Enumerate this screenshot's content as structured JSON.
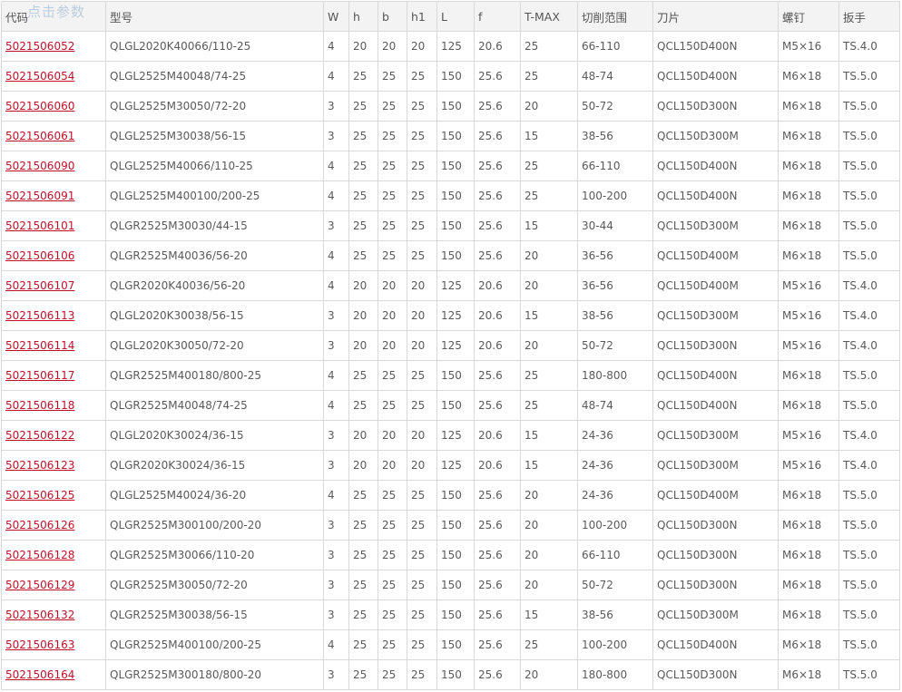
{
  "watermark": "点击参数",
  "table": {
    "headers": [
      "代码",
      "型号",
      "W",
      "h",
      "b",
      "h1",
      "L",
      "f",
      "T-MAX",
      "切削范围",
      "刀片",
      "螺钉",
      "扳手"
    ],
    "rows": [
      [
        "5021506052",
        "QLGL2020K40066/110-25",
        "4",
        "20",
        "20",
        "20",
        "125",
        "20.6",
        "25",
        "66-110",
        "QCL150D400N",
        "M5×16",
        "TS.4.0"
      ],
      [
        "5021506054",
        "QLGL2525M40048/74-25",
        "4",
        "25",
        "25",
        "25",
        "150",
        "25.6",
        "25",
        "48-74",
        "QCL150D400N",
        "M6×18",
        "TS.5.0"
      ],
      [
        "5021506060",
        "QLGL2525M30050/72-20",
        "3",
        "25",
        "25",
        "25",
        "150",
        "25.6",
        "20",
        "50-72",
        "QCL150D300N",
        "M6×18",
        "TS.5.0"
      ],
      [
        "5021506061",
        "QLGL2525M30038/56-15",
        "3",
        "25",
        "25",
        "25",
        "150",
        "25.6",
        "15",
        "38-56",
        "QCL150D300M",
        "M6×18",
        "TS.5.0"
      ],
      [
        "5021506090",
        "QLGL2525M40066/110-25",
        "4",
        "25",
        "25",
        "25",
        "150",
        "25.6",
        "25",
        "66-110",
        "QCL150D400N",
        "M6×18",
        "TS.5.0"
      ],
      [
        "5021506091",
        "QLGL2525M400100/200-25",
        "4",
        "25",
        "25",
        "25",
        "150",
        "25.6",
        "25",
        "100-200",
        "QCL150D400N",
        "M6×18",
        "TS.5.0"
      ],
      [
        "5021506101",
        "QLGR2525M30030/44-15",
        "3",
        "25",
        "25",
        "25",
        "150",
        "25.6",
        "15",
        "30-44",
        "QCL150D300M",
        "M6×18",
        "TS.5.0"
      ],
      [
        "5021506106",
        "QLGR2525M40036/56-20",
        "4",
        "25",
        "25",
        "25",
        "150",
        "25.6",
        "20",
        "36-56",
        "QCL150D400M",
        "M6×18",
        "TS.5.0"
      ],
      [
        "5021506107",
        "QLGR2020K40036/56-20",
        "4",
        "20",
        "20",
        "20",
        "125",
        "20.6",
        "20",
        "36-56",
        "QCL150D400M",
        "M5×16",
        "TS.4.0"
      ],
      [
        "5021506113",
        "QLGL2020K30038/56-15",
        "3",
        "20",
        "20",
        "20",
        "125",
        "20.6",
        "15",
        "38-56",
        "QCL150D300M",
        "M5×16",
        "TS.4.0"
      ],
      [
        "5021506114",
        "QLGL2020K30050/72-20",
        "3",
        "20",
        "20",
        "20",
        "125",
        "20.6",
        "20",
        "50-72",
        "QCL150D300N",
        "M5×16",
        "TS.4.0"
      ],
      [
        "5021506117",
        "QLGR2525M400180/800-25",
        "4",
        "25",
        "25",
        "25",
        "150",
        "25.6",
        "25",
        "180-800",
        "QCL150D400N",
        "M6×18",
        "TS.5.0"
      ],
      [
        "5021506118",
        "QLGR2525M40048/74-25",
        "4",
        "25",
        "25",
        "25",
        "150",
        "25.6",
        "25",
        "48-74",
        "QCL150D400N",
        "M6×18",
        "TS.5.0"
      ],
      [
        "5021506122",
        "QLGL2020K30024/36-15",
        "3",
        "20",
        "20",
        "20",
        "125",
        "20.6",
        "15",
        "24-36",
        "QCL150D300M",
        "M5×16",
        "TS.4.0"
      ],
      [
        "5021506123",
        "QLGR2020K30024/36-15",
        "3",
        "20",
        "20",
        "20",
        "125",
        "20.6",
        "15",
        "24-36",
        "QCL150D300M",
        "M5×16",
        "TS.4.0"
      ],
      [
        "5021506125",
        "QLGL2525M40024/36-20",
        "4",
        "25",
        "25",
        "25",
        "150",
        "25.6",
        "20",
        "24-36",
        "QCL150D400M",
        "M6×18",
        "TS.5.0"
      ],
      [
        "5021506126",
        "QLGR2525M300100/200-20",
        "3",
        "25",
        "25",
        "25",
        "150",
        "25.6",
        "20",
        "100-200",
        "QCL150D300N",
        "M6×18",
        "TS.5.0"
      ],
      [
        "5021506128",
        "QLGR2525M30066/110-20",
        "3",
        "25",
        "25",
        "25",
        "150",
        "25.6",
        "20",
        "66-110",
        "QCL150D300N",
        "M6×18",
        "TS.5.0"
      ],
      [
        "5021506129",
        "QLGR2525M30050/72-20",
        "3",
        "25",
        "25",
        "25",
        "150",
        "25.6",
        "20",
        "50-72",
        "QCL150D300N",
        "M6×18",
        "TS.5.0"
      ],
      [
        "5021506132",
        "QLGR2525M30038/56-15",
        "3",
        "25",
        "25",
        "25",
        "150",
        "25.6",
        "15",
        "38-56",
        "QCL150D300M",
        "M6×18",
        "TS.5.0"
      ],
      [
        "5021506163",
        "QLGR2525M400100/200-25",
        "4",
        "25",
        "25",
        "25",
        "150",
        "25.6",
        "25",
        "100-200",
        "QCL150D400N",
        "M6×18",
        "TS.5.0"
      ],
      [
        "5021506164",
        "QLGR2525M300180/800-20",
        "3",
        "25",
        "25",
        "25",
        "150",
        "25.6",
        "20",
        "180-800",
        "QCL150D300N",
        "M6×18",
        "TS.5.0"
      ]
    ]
  },
  "colors": {
    "link": "#c0102a",
    "border": "#d9d9d9",
    "text": "#5a5a5a"
  }
}
